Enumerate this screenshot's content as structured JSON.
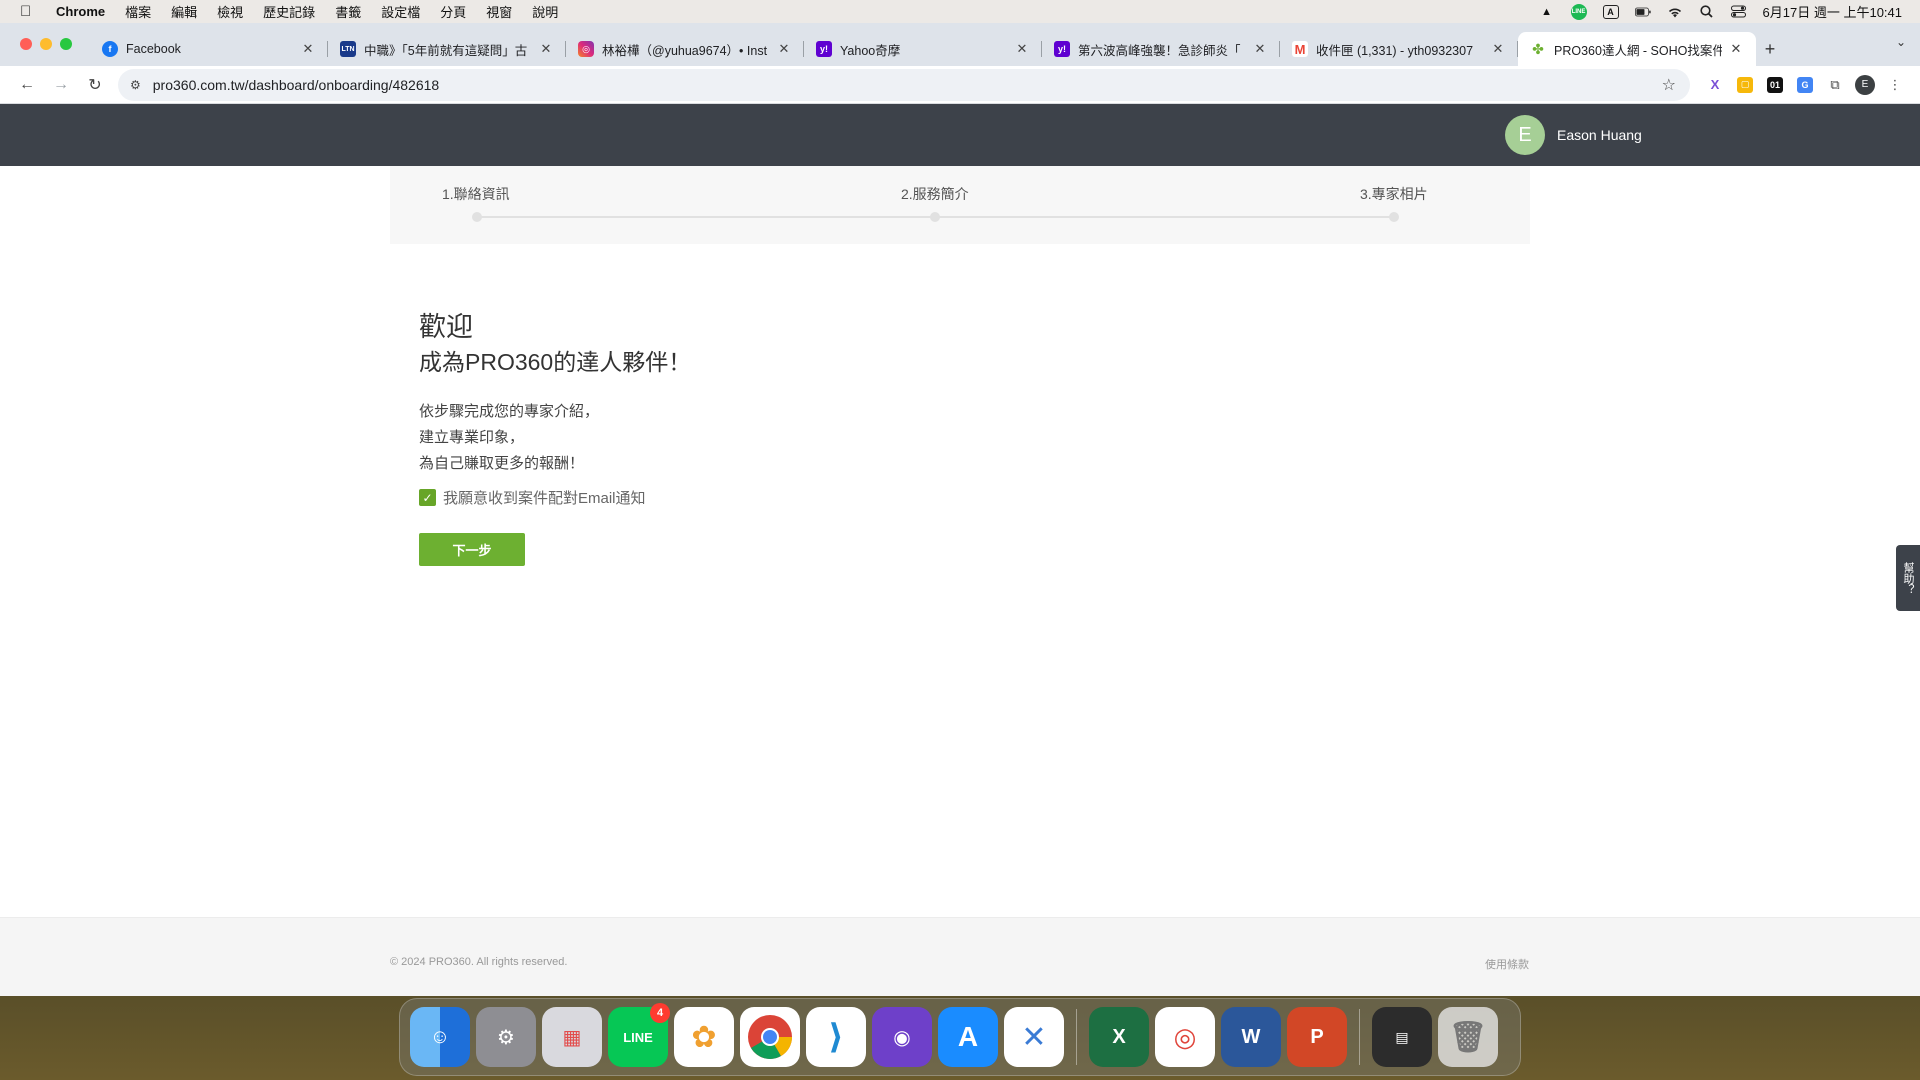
{
  "menubar": {
    "app": "Chrome",
    "items": [
      "檔案",
      "編輯",
      "檢視",
      "歷史記錄",
      "書籤",
      "設定檔",
      "分頁",
      "視窗",
      "說明"
    ],
    "input_method": "A",
    "clock": "6月17日 週一 上午10:41"
  },
  "tabs": [
    {
      "title": "Facebook",
      "icon": "facebook-icon",
      "color": "#1877f2"
    },
    {
      "title": "中職》「5年前就有這疑問」古",
      "icon": "ltn-icon",
      "color": "#1a3a8a"
    },
    {
      "title": "林裕樺（@yuhua9674）• Inst",
      "icon": "instagram-icon",
      "color": "#d6249f"
    },
    {
      "title": "Yahoo奇摩",
      "icon": "yahoo-icon",
      "color": "#5f01d1"
    },
    {
      "title": "第六波高峰強襲！急診師炎「",
      "icon": "yahoo-icon",
      "color": "#5f01d1"
    },
    {
      "title": "收件匣 (1,331) - yth0932307",
      "icon": "gmail-icon",
      "color": "#ea4335"
    },
    {
      "title": "PRO360達人網 - SOHO找案件",
      "icon": "pro360-icon",
      "color": "#6db031"
    }
  ],
  "address_bar": {
    "url": "pro360.com.tw/dashboard/onboarding/482618"
  },
  "profile_initial": "E",
  "site_header": {
    "user_initial": "E",
    "user_name": "Eason Huang"
  },
  "steps": [
    {
      "label": "1.聯絡資訊"
    },
    {
      "label": "2.服務簡介"
    },
    {
      "label": "3.專家相片"
    }
  ],
  "welcome": {
    "line1": "歡迎",
    "line2": "成為PRO360的達人夥伴！",
    "desc1": "依步驟完成您的專家介紹，",
    "desc2": "建立專業印象，",
    "desc3": "為自己賺取更多的報酬！",
    "checkbox_label": "我願意收到案件配對Email通知",
    "checkbox_checked": true,
    "next_button": "下一步"
  },
  "help_tab": "幫助？",
  "footer": {
    "copyright": "© 2024 PRO360. All rights reserved.",
    "terms": "使用條款"
  },
  "dock": {
    "line_badge": "4",
    "excel_letter": "X",
    "word_letter": "W",
    "powerpoint_letter": "P"
  },
  "colors": {
    "brand_green": "#6db031",
    "header_bg": "#3d424a",
    "avatar_green": "#a6cf96"
  }
}
